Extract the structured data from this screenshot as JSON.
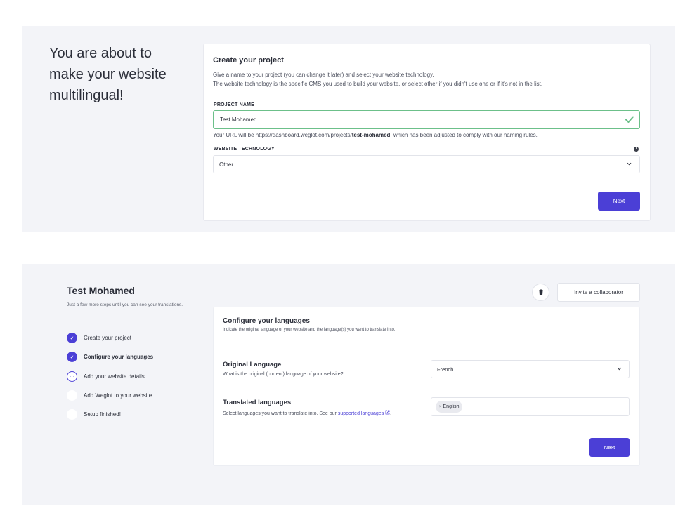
{
  "setup": {
    "hero_text": "You are about to make your website multilingual!",
    "title": "Create your project",
    "subtitle_line1": "Give a name to your project (you can change it later) and select your website technology.",
    "subtitle_line2": "The website technology is the specific CMS you used to build your website, or select other if you didn't use one or if it's not in the list.",
    "project_name_label": "PROJECT NAME",
    "project_name_value": "Test Mohamed",
    "url_prefix": "Your URL will be https://dashboard.weglot.com/projects/",
    "url_slug": "test-mohamed",
    "url_suffix": ", which has been adjusted to comply with our naming rules.",
    "technology_label": "WEBSITE TECHNOLOGY",
    "technology_value": "Other",
    "next_label": "Next",
    "accent_color": "#4b3fd6",
    "valid_color": "#6cc08a"
  },
  "project": {
    "name": "Test Mohamed",
    "subtitle": "Just a few more steps until you can see your translations.",
    "delete_icon": "trash-icon",
    "invite_label": "Invite a collaborator",
    "steps": [
      {
        "label": "Create your project",
        "state": "done"
      },
      {
        "label": "Configure your languages",
        "state": "done"
      },
      {
        "label": "Add your website details",
        "state": "current"
      },
      {
        "label": "Add Weglot to your website",
        "state": "todo"
      },
      {
        "label": "Setup finished!",
        "state": "todo"
      }
    ],
    "card_title": "Configure your languages",
    "card_subtitle": "Indicate the original language of your website and the language(s) you want to translate into.",
    "original_title": "Original Language",
    "original_sub": "What is the original (current) language of your website?",
    "original_value": "French",
    "translated_title": "Translated languages",
    "translated_sub": "Select languages you want to translate into. See our ",
    "translated_link": "supported languages",
    "translated_tag_remove": "×",
    "translated_tag": "English",
    "next_label": "Next"
  }
}
